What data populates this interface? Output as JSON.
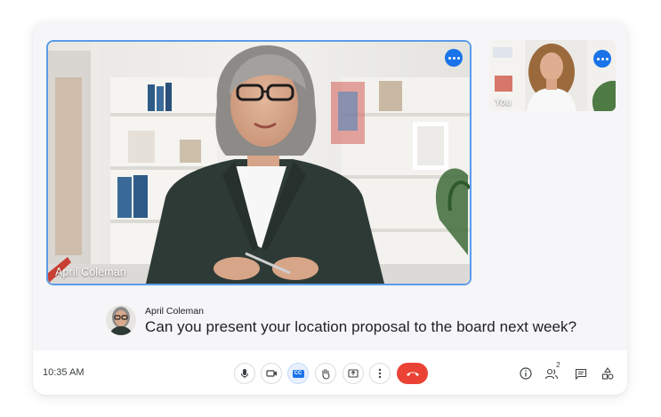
{
  "main_tile": {
    "participant_name": "April Coleman"
  },
  "self_tile": {
    "label": "You"
  },
  "caption": {
    "speaker": "April Coleman",
    "text": "Can you present your location proposal to the board next week?"
  },
  "toolbar": {
    "time": "10:35 AM",
    "controls": [
      "microphone-icon",
      "camera-icon",
      "captions-icon",
      "raise-hand-icon",
      "present-icon",
      "more-options-icon",
      "end-call-icon"
    ],
    "captions_label": "CC",
    "people_count": "2",
    "right_icons": [
      "info-icon",
      "people-icon",
      "chat-icon",
      "activities-icon"
    ]
  },
  "colors": {
    "accent": "#1a73e8",
    "active_tile_border": "#5b9ce8",
    "end_call": "#ea4335",
    "card_background": "#f6f6f8"
  }
}
